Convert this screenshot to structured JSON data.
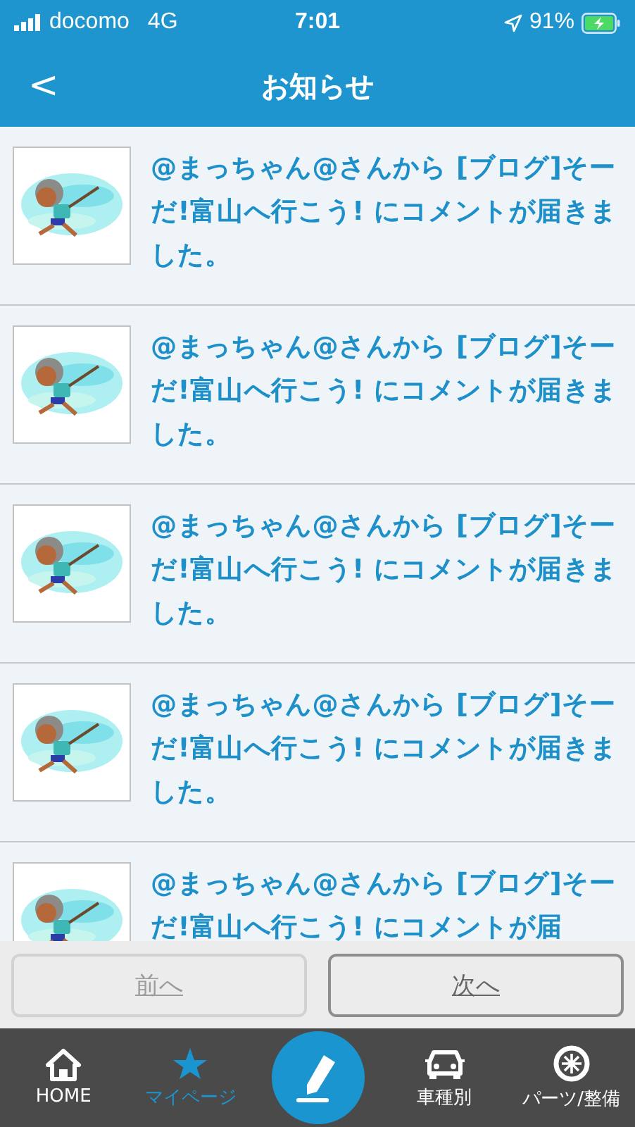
{
  "status_bar": {
    "carrier": "docomo",
    "network": "4G",
    "time": "7:01",
    "battery": "91%"
  },
  "header": {
    "back": "<",
    "title": "お知らせ"
  },
  "notifications": [
    {
      "text": "@まっちゃん@さんから [ブログ]そーだ!富山へ行こう! にコメントが届きました。"
    },
    {
      "text": "@まっちゃん@さんから [ブログ]そーだ!富山へ行こう! にコメントが届きました。"
    },
    {
      "text": "@まっちゃん@さんから [ブログ]そーだ!富山へ行こう! にコメントが届きました。"
    },
    {
      "text": "@まっちゃん@さんから [ブログ]そーだ!富山へ行こう! にコメントが届きました。"
    },
    {
      "text": "@まっちゃん@さんから [ブログ]そーだ!富山へ行こう! にコメントが届"
    }
  ],
  "pager": [
    {
      "label": "前へ",
      "disabled": true
    },
    {
      "label": "次へ",
      "disabled": false
    }
  ],
  "tab_bar": [
    {
      "kind": "home",
      "label": "HOME",
      "selected": false
    },
    {
      "kind": "star",
      "label": "マイページ",
      "selected": true
    },
    {
      "kind": "post",
      "selected": false
    },
    {
      "kind": "car",
      "label": "車種別",
      "selected": false
    },
    {
      "kind": "wheel",
      "label": "パーツ/整備",
      "selected": false
    }
  ]
}
